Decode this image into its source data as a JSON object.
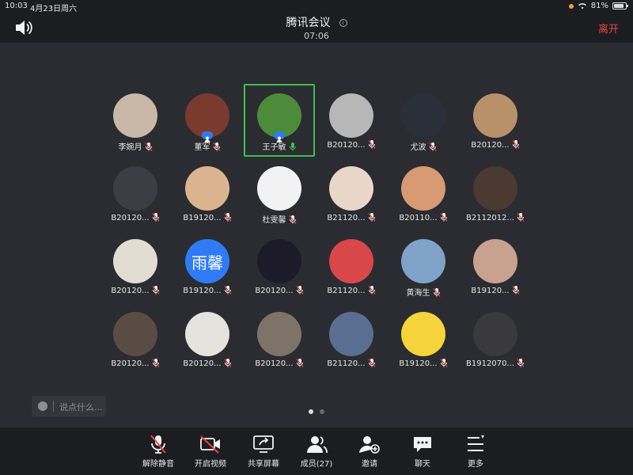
{
  "status_bar": {
    "time": "10:03",
    "date": "4月23日周六",
    "battery": "81%"
  },
  "header": {
    "title": "腾讯会议",
    "duration": "07:06",
    "leave_label": "离开"
  },
  "participants": [
    {
      "name": "李婉月",
      "mic": "muted",
      "bg": "#c9b8a8"
    },
    {
      "name": "董军",
      "mic": "muted",
      "bg": "#7a3b2e",
      "host": true
    },
    {
      "name": "王子敏",
      "mic": "on",
      "bg": "#4d8b3a",
      "host": true,
      "active": true
    },
    {
      "name": "B20120...",
      "mic": "muted",
      "bg": "#b7b7b7"
    },
    {
      "name": "尤波",
      "mic": "muted",
      "bg": "#2a2f3a"
    },
    {
      "name": "B20120...",
      "mic": "muted",
      "bg": "#b8916b"
    },
    {
      "name": "B20120...",
      "mic": "muted",
      "bg": "#3b3f45"
    },
    {
      "name": "B19120...",
      "mic": "muted",
      "bg": "#d9b48f"
    },
    {
      "name": "杜雯馨",
      "mic": "muted",
      "bg": "#f2f2f2"
    },
    {
      "name": "B21120...",
      "mic": "muted",
      "bg": "#e9d6c9"
    },
    {
      "name": "B20110...",
      "mic": "muted",
      "bg": "#d79a72"
    },
    {
      "name": "B2112012...",
      "mic": "muted",
      "bg": "#4a3a32"
    },
    {
      "name": "B20120...",
      "mic": "muted",
      "bg": "#e2ddd2"
    },
    {
      "name": "B19120...",
      "mic": "muted",
      "bg": "#2f7bf5",
      "text": "雨馨"
    },
    {
      "name": "B20120...",
      "mic": "muted",
      "bg": "#1d1b2a"
    },
    {
      "name": "B21120...",
      "mic": "muted",
      "bg": "#d8474a"
    },
    {
      "name": "黄海生",
      "mic": "muted",
      "bg": "#7fa3c8"
    },
    {
      "name": "B19120...",
      "mic": "muted",
      "bg": "#c9a18f"
    },
    {
      "name": "B20120...",
      "mic": "muted",
      "bg": "#5a4c44"
    },
    {
      "name": "B20120...",
      "mic": "muted",
      "bg": "#e6e2dc"
    },
    {
      "name": "B20120...",
      "mic": "muted",
      "bg": "#7e7368"
    },
    {
      "name": "B21120...",
      "mic": "muted",
      "bg": "#5a6e92"
    },
    {
      "name": "B19120...",
      "mic": "muted",
      "bg": "#f5d33b"
    },
    {
      "name": "B1912070...",
      "mic": "muted",
      "bg": "#3a3a3c"
    }
  ],
  "comment": {
    "placeholder": "说点什么..."
  },
  "pager": {
    "pages": 2,
    "current": 1
  },
  "toolbar": {
    "unmute": "解除静音",
    "video": "开启视频",
    "share": "共享屏幕",
    "members": "成员(27)",
    "invite": "邀请",
    "chat": "聊天",
    "more": "更多"
  },
  "colors": {
    "accent_green": "#3ac24a",
    "leave_red": "#e8453c",
    "mic_muted_red": "#e8453c",
    "host_blue": "#2f7bf5"
  }
}
